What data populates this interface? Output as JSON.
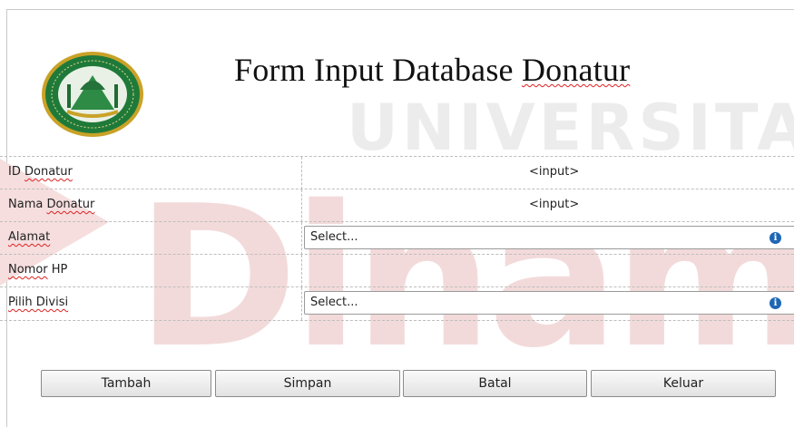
{
  "title": {
    "word1": "Form Input Database",
    "word2": "Donatur"
  },
  "fields": [
    {
      "label_a": "ID",
      "label_b": "Donatur",
      "value": "<input>"
    },
    {
      "label_a": "Nama",
      "label_b": "Donatur",
      "value": "<input>"
    },
    {
      "label_a": "",
      "label_b": "Alamat",
      "value": "Select..."
    },
    {
      "label_a": "",
      "label_b": "Nomor",
      "label_c": "HP",
      "value": ""
    },
    {
      "label_a": "",
      "label_b": "Pilih Divisi",
      "value": "Select..."
    }
  ],
  "info_icon_glyph": "i",
  "buttons": {
    "add": "Tambah",
    "save": "Simpan",
    "cancel": "Batal",
    "exit": "Keluar"
  },
  "watermark": {
    "line1": "UNIVERSITAS",
    "line2": "Dinami"
  },
  "colors": {
    "watermark_red": "#f3d6d6",
    "watermark_grey": "#ececec",
    "logo_green": "#2e7d32",
    "logo_gold": "#c9a227",
    "info_blue": "#1e66b5"
  }
}
